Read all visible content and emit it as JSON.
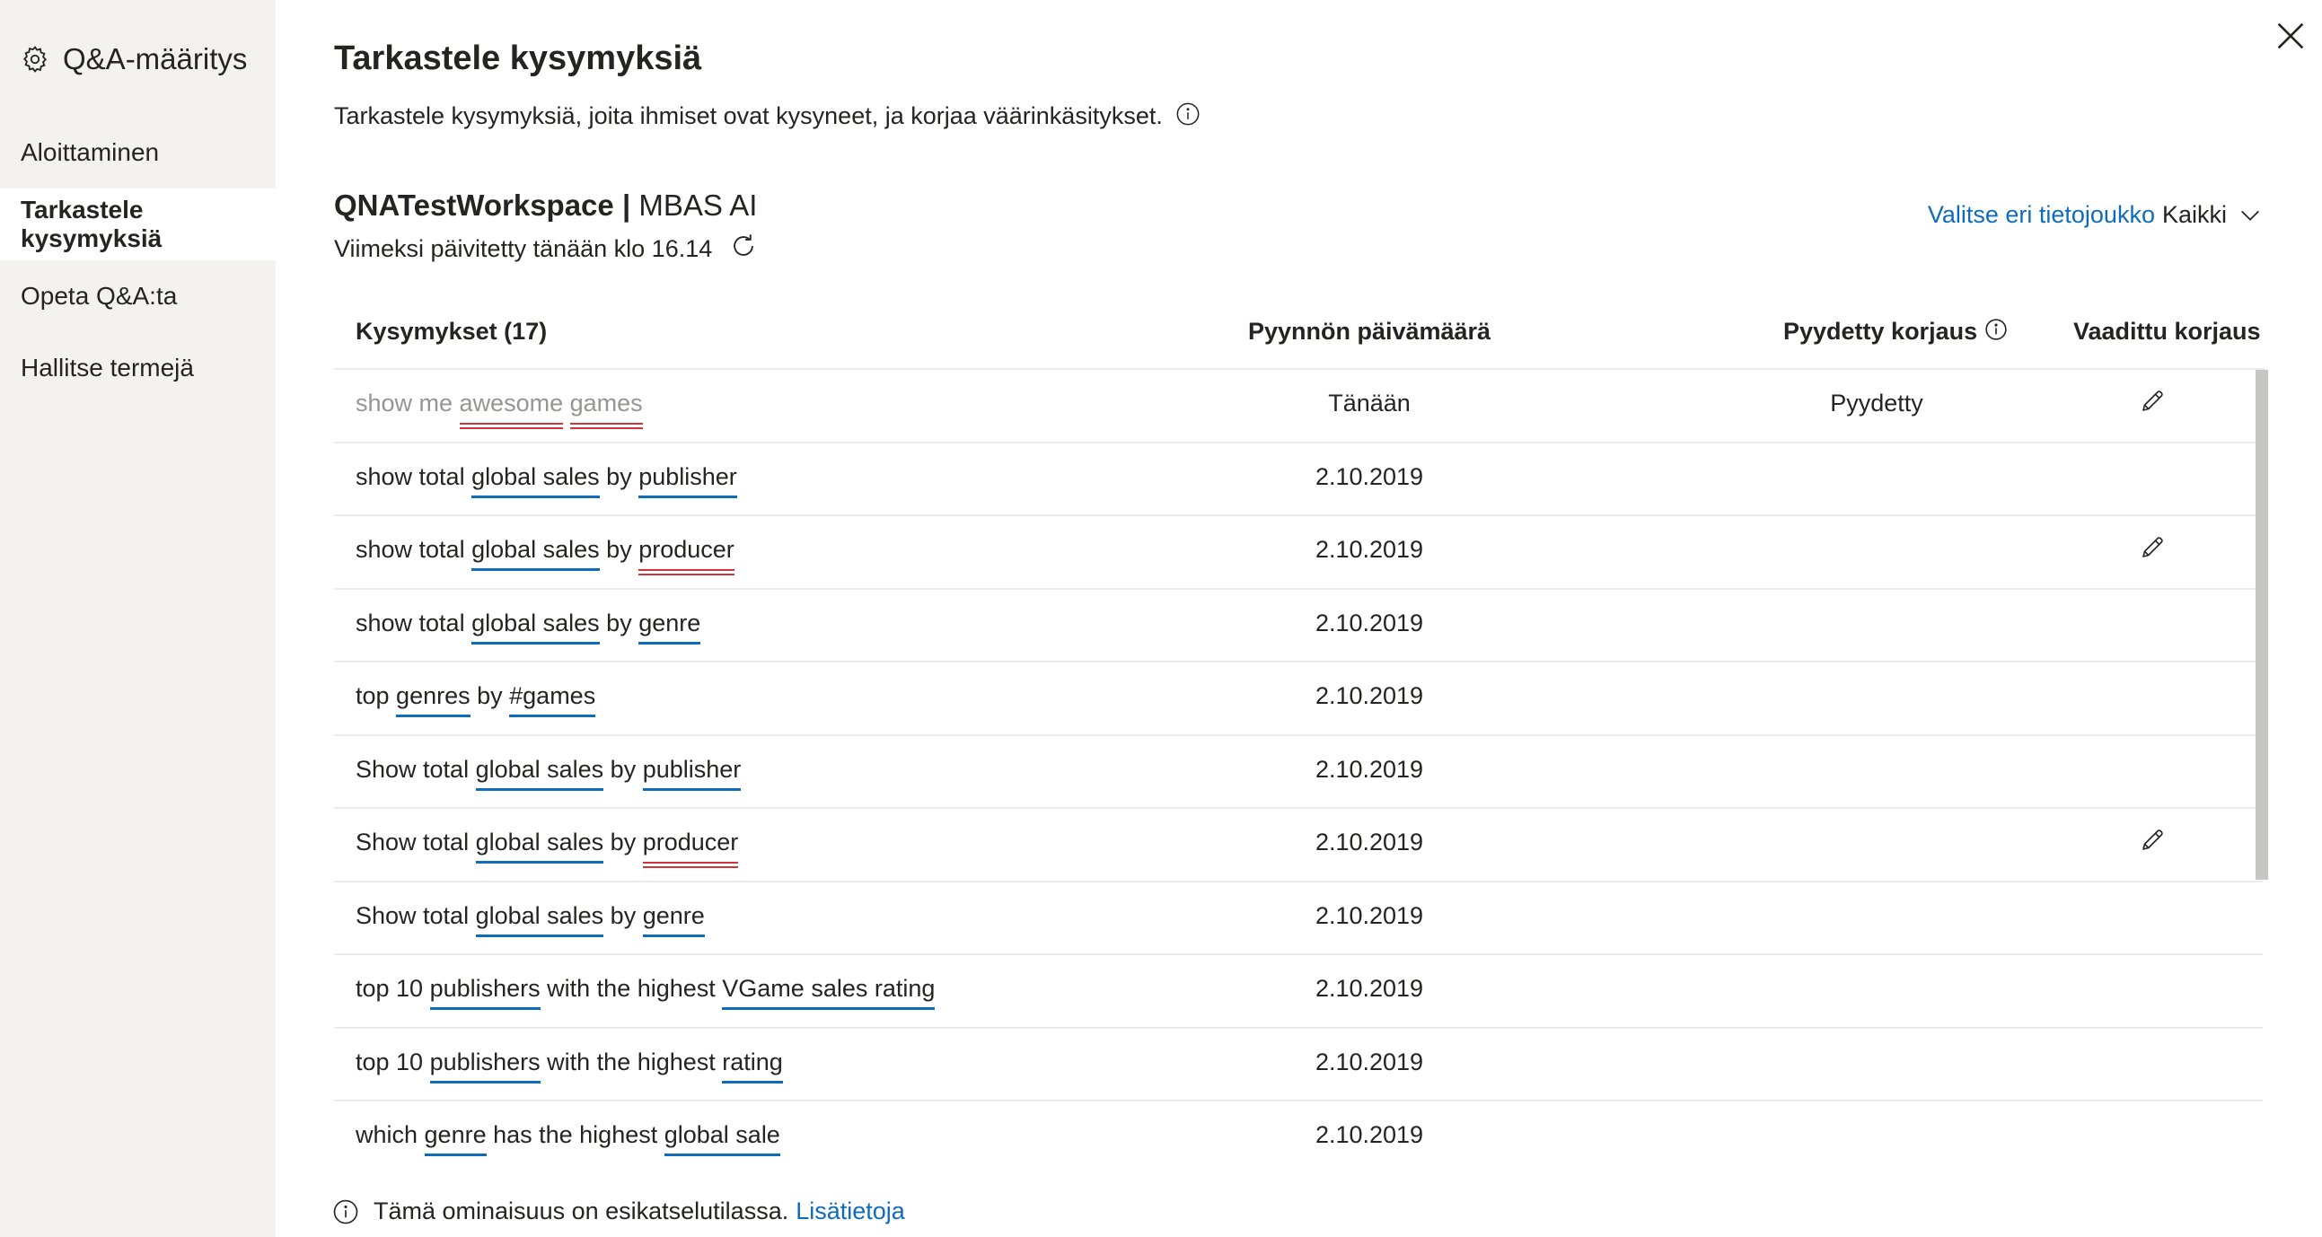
{
  "sidebar": {
    "title": "Q&A-määritys",
    "items": [
      {
        "label": "Aloittaminen",
        "active": false
      },
      {
        "label": "Tarkastele kysymyksiä",
        "active": true
      },
      {
        "label": "Opeta Q&A:ta",
        "active": false
      },
      {
        "label": "Hallitse termejä",
        "active": false
      }
    ]
  },
  "header": {
    "title": "Tarkastele kysymyksiä",
    "description": "Tarkastele kysymyksiä, joita ihmiset ovat kysyneet, ja korjaa väärinkäsitykset."
  },
  "workspace": {
    "name": "QNATestWorkspace",
    "separator": "|",
    "dataset": "MBAS AI",
    "updated": "Viimeksi päivitetty tänään klo 16.14"
  },
  "dataset_picker": {
    "link_label": "Valitse eri tietojoukko",
    "selected": "Kaikki"
  },
  "table": {
    "columns": {
      "questions": "Kysymykset (17)",
      "date": "Pyynnön päivämäärä",
      "requested_fix": "Pyydetty korjaus",
      "required_fix": "Vaadittu korjaus"
    },
    "rows": [
      {
        "muted": true,
        "parts": [
          {
            "t": "show me "
          },
          {
            "t": "awesome",
            "u": "red"
          },
          {
            "t": " "
          },
          {
            "t": "games",
            "u": "red"
          }
        ],
        "date": "Tänään",
        "fix": "Pyydetty",
        "edit": true
      },
      {
        "parts": [
          {
            "t": "show total "
          },
          {
            "t": "global sales",
            "u": "blue"
          },
          {
            "t": " by "
          },
          {
            "t": "publisher",
            "u": "blue"
          }
        ],
        "date": "2.10.2019",
        "fix": "",
        "edit": false
      },
      {
        "parts": [
          {
            "t": "show total "
          },
          {
            "t": "global sales",
            "u": "blue"
          },
          {
            "t": " by "
          },
          {
            "t": "producer",
            "u": "red"
          }
        ],
        "date": "2.10.2019",
        "fix": "",
        "edit": true
      },
      {
        "parts": [
          {
            "t": "show total "
          },
          {
            "t": "global sales",
            "u": "blue"
          },
          {
            "t": " by "
          },
          {
            "t": "genre",
            "u": "blue"
          }
        ],
        "date": "2.10.2019",
        "fix": "",
        "edit": false
      },
      {
        "parts": [
          {
            "t": "top "
          },
          {
            "t": "genres",
            "u": "blue"
          },
          {
            "t": " by "
          },
          {
            "t": "#games",
            "u": "blue"
          }
        ],
        "date": "2.10.2019",
        "fix": "",
        "edit": false
      },
      {
        "parts": [
          {
            "t": "Show total "
          },
          {
            "t": "global sales",
            "u": "blue"
          },
          {
            "t": " by "
          },
          {
            "t": "publisher",
            "u": "blue"
          }
        ],
        "date": "2.10.2019",
        "fix": "",
        "edit": false
      },
      {
        "parts": [
          {
            "t": "Show total "
          },
          {
            "t": "global sales",
            "u": "blue"
          },
          {
            "t": " by "
          },
          {
            "t": "producer",
            "u": "red"
          }
        ],
        "date": "2.10.2019",
        "fix": "",
        "edit": true
      },
      {
        "parts": [
          {
            "t": "Show total "
          },
          {
            "t": "global sales",
            "u": "blue"
          },
          {
            "t": " by "
          },
          {
            "t": "genre",
            "u": "blue"
          }
        ],
        "date": "2.10.2019",
        "fix": "",
        "edit": false
      },
      {
        "parts": [
          {
            "t": "top 10 "
          },
          {
            "t": "publishers",
            "u": "blue"
          },
          {
            "t": " with the highest "
          },
          {
            "t": "VGame sales rating",
            "u": "blue"
          }
        ],
        "date": "2.10.2019",
        "fix": "",
        "edit": false
      },
      {
        "parts": [
          {
            "t": "top 10 "
          },
          {
            "t": "publishers",
            "u": "blue"
          },
          {
            "t": " with the highest "
          },
          {
            "t": "rating",
            "u": "blue"
          }
        ],
        "date": "2.10.2019",
        "fix": "",
        "edit": false
      },
      {
        "parts": [
          {
            "t": "which "
          },
          {
            "t": "genre",
            "u": "blue"
          },
          {
            "t": " has the highest "
          },
          {
            "t": "global sale",
            "u": "blue"
          }
        ],
        "date": "2.10.2019",
        "fix": "",
        "edit": false
      }
    ]
  },
  "footer": {
    "text": "Tämä ominaisuus on esikatselutilassa.",
    "link": "Lisätietoja"
  },
  "icons": {
    "settings": "gear-icon",
    "close": "close-icon",
    "info": "info-icon",
    "refresh": "refresh-icon",
    "dropdown": "chevron-down-icon",
    "edit": "pencil-icon"
  },
  "colors": {
    "accent": "#0f6cbd",
    "error_underline": "#d13438",
    "sidebar_bg": "#f3f2f1"
  }
}
